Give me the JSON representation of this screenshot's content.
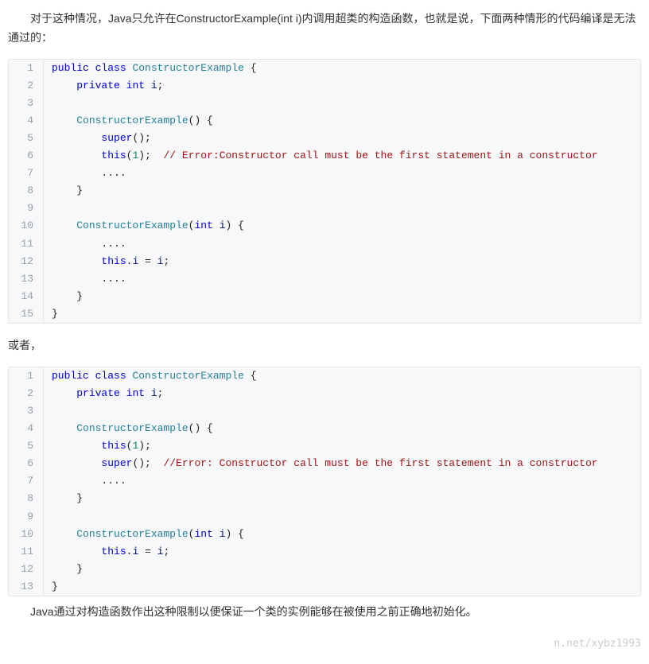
{
  "para1": "对于这种情况，Java只允许在ConstructorExample(int i)内调用超类的构造函数，也就是说，下面两种情形的代码编译是无法通过的：",
  "para2": "或者，",
  "para3": "Java通过对构造函数作出这种限制以便保证一个类的实例能够在被使用之前正确地初始化。",
  "watermark": "n.net/xybz1993",
  "code1": {
    "lines": [
      {
        "n": "1",
        "segs": [
          [
            "kw",
            "public"
          ],
          [
            "",
            " "
          ],
          [
            "kw",
            "class"
          ],
          [
            "",
            " "
          ],
          [
            "cls",
            "ConstructorExample"
          ],
          [
            "",
            " {"
          ]
        ]
      },
      {
        "n": "2",
        "segs": [
          [
            "",
            "    "
          ],
          [
            "kw",
            "private"
          ],
          [
            "",
            " "
          ],
          [
            "kw",
            "int"
          ],
          [
            "",
            " "
          ],
          [
            "prop",
            "i"
          ],
          [
            "",
            ";"
          ]
        ]
      },
      {
        "n": "3",
        "segs": [
          [
            "",
            ""
          ]
        ]
      },
      {
        "n": "4",
        "segs": [
          [
            "",
            "    "
          ],
          [
            "cls",
            "ConstructorExample"
          ],
          [
            "",
            "() {"
          ]
        ]
      },
      {
        "n": "5",
        "segs": [
          [
            "",
            "        "
          ],
          [
            "kw",
            "super"
          ],
          [
            "",
            "();"
          ]
        ]
      },
      {
        "n": "6",
        "segs": [
          [
            "",
            "        "
          ],
          [
            "this",
            "this"
          ],
          [
            "",
            "("
          ],
          [
            "num",
            "1"
          ],
          [
            "",
            ");  "
          ],
          [
            "err",
            "// Error:Constructor call must be the first statement in a constructor"
          ]
        ]
      },
      {
        "n": "7",
        "segs": [
          [
            "",
            "        ...."
          ]
        ]
      },
      {
        "n": "8",
        "segs": [
          [
            "",
            "    }"
          ]
        ]
      },
      {
        "n": "9",
        "segs": [
          [
            "",
            ""
          ]
        ]
      },
      {
        "n": "10",
        "segs": [
          [
            "",
            "    "
          ],
          [
            "cls",
            "ConstructorExample"
          ],
          [
            "",
            "("
          ],
          [
            "kw",
            "int"
          ],
          [
            "",
            " "
          ],
          [
            "prop",
            "i"
          ],
          [
            "",
            ") {"
          ]
        ]
      },
      {
        "n": "11",
        "segs": [
          [
            "",
            "        ...."
          ]
        ]
      },
      {
        "n": "12",
        "segs": [
          [
            "",
            "        "
          ],
          [
            "this",
            "this"
          ],
          [
            "",
            "."
          ],
          [
            "prop",
            "i"
          ],
          [
            "",
            " = "
          ],
          [
            "prop",
            "i"
          ],
          [
            "",
            ";"
          ]
        ]
      },
      {
        "n": "13",
        "segs": [
          [
            "",
            "        ...."
          ]
        ]
      },
      {
        "n": "14",
        "segs": [
          [
            "",
            "    }"
          ]
        ]
      },
      {
        "n": "15",
        "segs": [
          [
            "",
            "}"
          ]
        ]
      }
    ]
  },
  "code2": {
    "lines": [
      {
        "n": "1",
        "segs": [
          [
            "kw",
            "public"
          ],
          [
            "",
            " "
          ],
          [
            "kw",
            "class"
          ],
          [
            "",
            " "
          ],
          [
            "cls",
            "ConstructorExample"
          ],
          [
            "",
            " {"
          ]
        ]
      },
      {
        "n": "2",
        "segs": [
          [
            "",
            "    "
          ],
          [
            "kw",
            "private"
          ],
          [
            "",
            " "
          ],
          [
            "kw",
            "int"
          ],
          [
            "",
            " "
          ],
          [
            "prop",
            "i"
          ],
          [
            "",
            ";"
          ]
        ]
      },
      {
        "n": "3",
        "segs": [
          [
            "",
            ""
          ]
        ]
      },
      {
        "n": "4",
        "segs": [
          [
            "",
            "    "
          ],
          [
            "cls",
            "ConstructorExample"
          ],
          [
            "",
            "() {"
          ]
        ]
      },
      {
        "n": "5",
        "segs": [
          [
            "",
            "        "
          ],
          [
            "this",
            "this"
          ],
          [
            "",
            "("
          ],
          [
            "num",
            "1"
          ],
          [
            "",
            ");"
          ]
        ]
      },
      {
        "n": "6",
        "segs": [
          [
            "",
            "        "
          ],
          [
            "kw",
            "super"
          ],
          [
            "",
            "();  "
          ],
          [
            "err",
            "//Error: Constructor call must be the first statement in a constructor"
          ]
        ]
      },
      {
        "n": "7",
        "segs": [
          [
            "",
            "        ...."
          ]
        ]
      },
      {
        "n": "8",
        "segs": [
          [
            "",
            "    }"
          ]
        ]
      },
      {
        "n": "9",
        "segs": [
          [
            "",
            ""
          ]
        ]
      },
      {
        "n": "10",
        "segs": [
          [
            "",
            "    "
          ],
          [
            "cls",
            "ConstructorExample"
          ],
          [
            "",
            "("
          ],
          [
            "kw",
            "int"
          ],
          [
            "",
            " "
          ],
          [
            "prop",
            "i"
          ],
          [
            "",
            ") {"
          ]
        ]
      },
      {
        "n": "11",
        "segs": [
          [
            "",
            "        "
          ],
          [
            "this",
            "this"
          ],
          [
            "",
            "."
          ],
          [
            "prop",
            "i"
          ],
          [
            "",
            " = "
          ],
          [
            "prop",
            "i"
          ],
          [
            "",
            ";"
          ]
        ]
      },
      {
        "n": "12",
        "segs": [
          [
            "",
            "    }"
          ]
        ]
      },
      {
        "n": "13",
        "segs": [
          [
            "",
            "}"
          ]
        ]
      }
    ]
  }
}
